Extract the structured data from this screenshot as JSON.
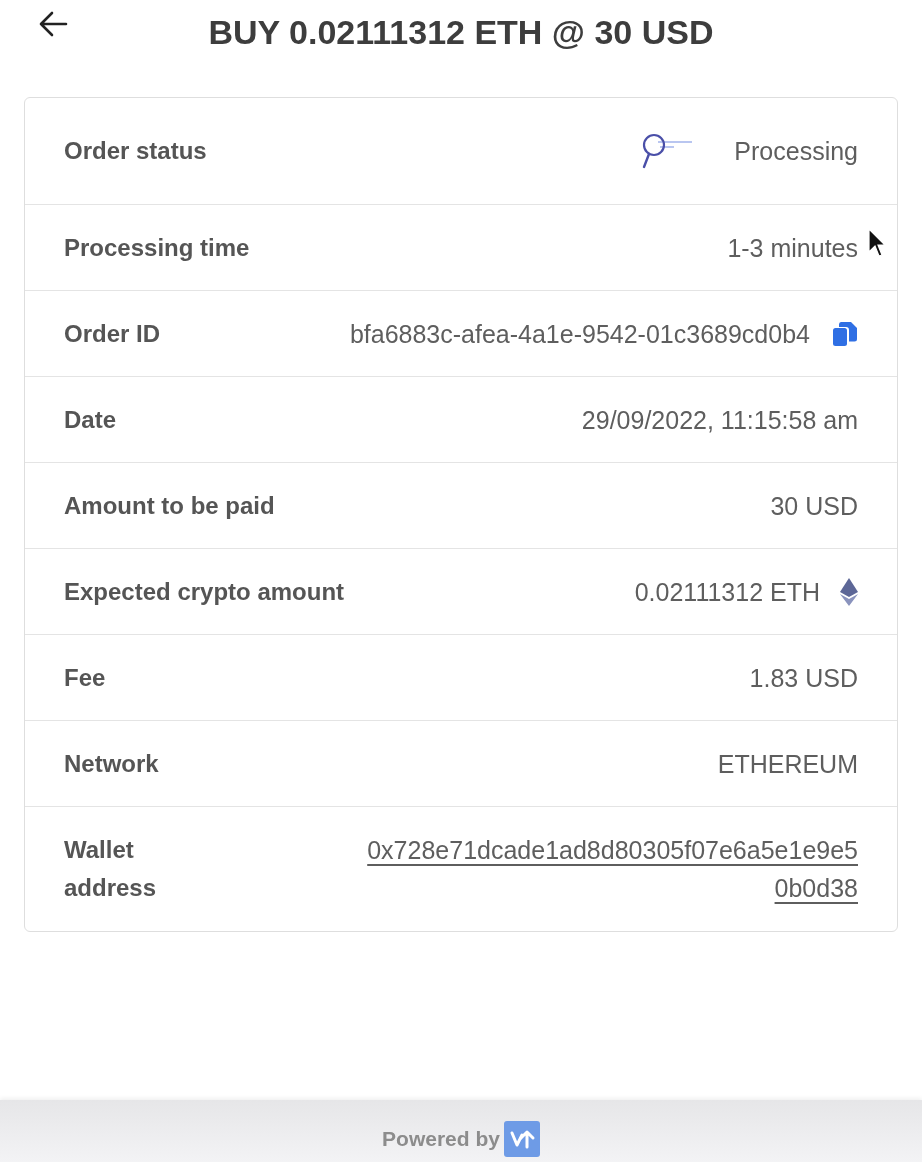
{
  "header": {
    "title": "BUY 0.02111312 ETH @ 30 USD"
  },
  "order_details": [
    {
      "label": "Order status",
      "value": "Processing",
      "kind": "status"
    },
    {
      "label": "Processing time",
      "value": "1-3 minutes",
      "kind": "text"
    },
    {
      "label": "Order ID",
      "value": "bfa6883c-afea-4a1e-9542-01c3689cd0b4",
      "kind": "copyable"
    },
    {
      "label": "Date",
      "value": "29/09/2022, 11:15:58 am",
      "kind": "text"
    },
    {
      "label": "Amount to be paid",
      "value": "30 USD",
      "kind": "text"
    },
    {
      "label": "Expected crypto amount",
      "value": "0.02111312 ETH",
      "kind": "crypto"
    },
    {
      "label": "Fee",
      "value": "1.83 USD",
      "kind": "text"
    },
    {
      "label": "Network",
      "value": "ETHEREUM",
      "kind": "text"
    },
    {
      "label": "Wallet address",
      "value": "0x728e71dcade1ad8d80305f07e6a5e1e9e50b0d38",
      "kind": "link"
    }
  ],
  "footer": {
    "text": "Powered by"
  }
}
